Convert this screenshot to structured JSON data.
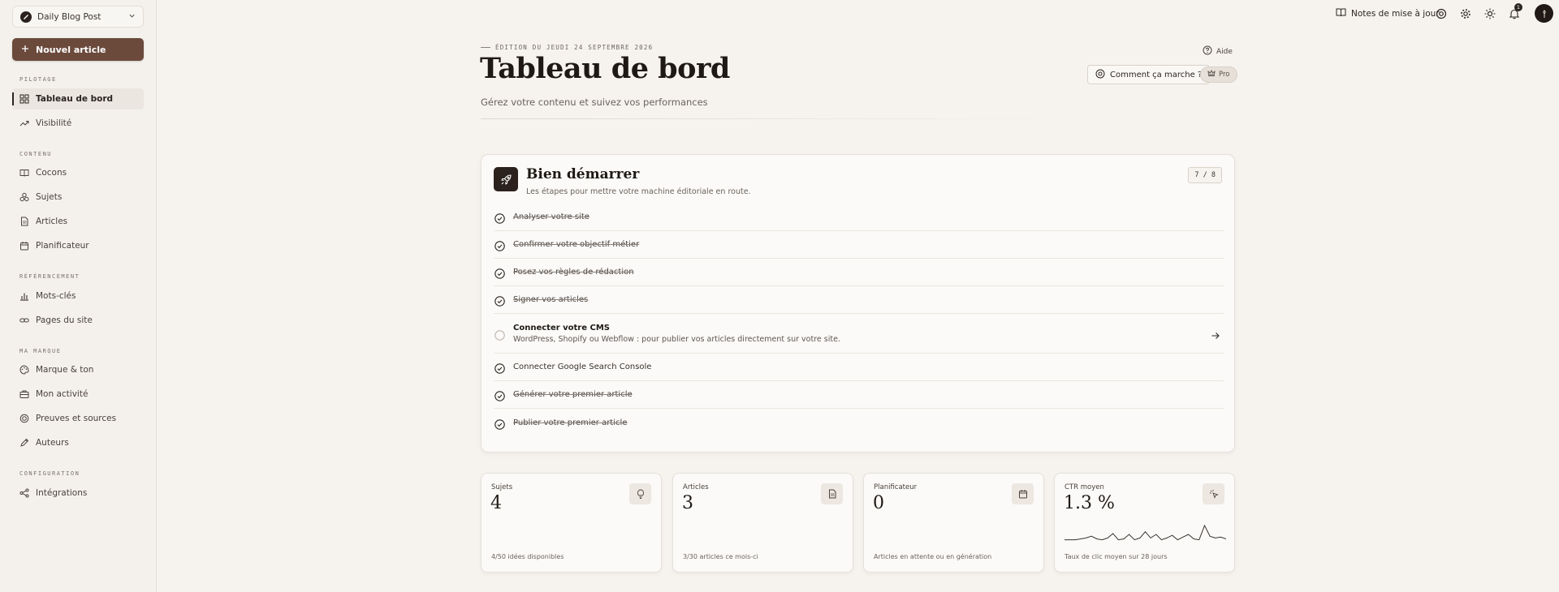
{
  "workspace": {
    "name": "Daily Blog Post"
  },
  "sidebar": {
    "new_article": "Nouvel article",
    "sections": [
      {
        "title": "PILOTAGE",
        "items": [
          {
            "label": "Tableau de bord",
            "icon": "grid-icon",
            "active": true
          },
          {
            "label": "Visibilité",
            "icon": "trending-up-icon"
          }
        ]
      },
      {
        "title": "CONTENU",
        "items": [
          {
            "label": "Cocons",
            "icon": "book-icon"
          },
          {
            "label": "Sujets",
            "icon": "topics-icon"
          },
          {
            "label": "Articles",
            "icon": "document-icon"
          },
          {
            "label": "Planificateur",
            "icon": "calendar-icon"
          }
        ]
      },
      {
        "title": "RÉFÉRENCEMENT",
        "items": [
          {
            "label": "Mots-clés",
            "icon": "bar-chart-icon"
          },
          {
            "label": "Pages du site",
            "icon": "link-icon"
          }
        ]
      },
      {
        "title": "MA MARQUE",
        "items": [
          {
            "label": "Marque & ton",
            "icon": "palette-icon"
          },
          {
            "label": "Mon activité",
            "icon": "briefcase-icon"
          },
          {
            "label": "Preuves et sources",
            "icon": "award-icon"
          },
          {
            "label": "Auteurs",
            "icon": "pen-icon"
          }
        ]
      },
      {
        "title": "CONFIGURATION",
        "items": [
          {
            "label": "Intégrations",
            "icon": "share-icon"
          }
        ]
      }
    ]
  },
  "topbar": {
    "release_notes": "Notes de mise à jour",
    "notification_count": "1"
  },
  "header": {
    "edition": "ÉDITION DU JEUDI 24 SEPTEMBRE 2026",
    "title": "Tableau de bord",
    "subtitle": "Gérez votre contenu et suivez vos performances",
    "help": "Aide",
    "how_it_works": "Comment ça marche ?",
    "pro": "Pro"
  },
  "getting_started": {
    "title": "Bien démarrer",
    "subtitle": "Les étapes pour mettre votre machine éditoriale en route.",
    "progress": "7 / 8",
    "steps": [
      {
        "label": "Analyser votre site",
        "done": true
      },
      {
        "label": "Confirmer votre objectif métier",
        "done": true
      },
      {
        "label": "Posez vos règles de rédaction",
        "done": true
      },
      {
        "label": "Signer vos articles",
        "done": true
      },
      {
        "label": "Connecter votre CMS",
        "done": false,
        "description": "WordPress, Shopify ou Webflow : pour publier vos articles directement sur votre site."
      },
      {
        "label": "Connecter Google Search Console",
        "done": true
      },
      {
        "label": "Générer votre premier article",
        "done": true
      },
      {
        "label": "Publier votre premier article",
        "done": true
      }
    ]
  },
  "stats": [
    {
      "label": "Sujets",
      "value": "4",
      "foot": "4/50 idées disponibles",
      "icon": "lightbulb-icon"
    },
    {
      "label": "Articles",
      "value": "3",
      "foot": "3/30 articles ce mois-ci",
      "icon": "document-icon"
    },
    {
      "label": "Planificateur",
      "value": "0",
      "foot": "Articles en attente ou en génération",
      "icon": "calendar-icon"
    },
    {
      "label": "CTR moyen",
      "value": "1.3 %",
      "foot": "Taux de clic moyen sur 28 jours",
      "icon": "cursor-click-icon"
    }
  ],
  "ctr_sparkline": [
    0.2,
    0.2,
    0.2,
    0.25,
    0.3,
    0.4,
    0.25,
    0.2,
    0.3,
    0.55,
    0.2,
    0.25,
    0.5,
    0.2,
    0.3,
    0.65,
    0.3,
    0.5,
    0.2,
    0.3,
    0.45,
    0.2,
    0.35,
    0.5,
    0.25,
    0.2,
    1.0,
    0.4,
    0.3,
    0.35,
    0.25
  ]
}
